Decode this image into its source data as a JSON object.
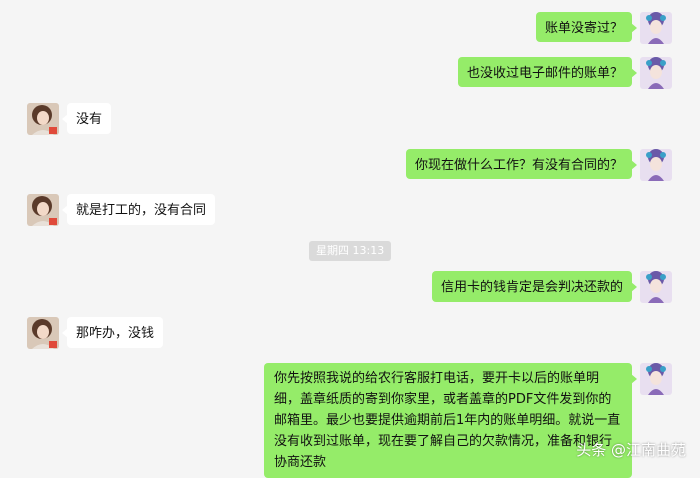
{
  "colors": {
    "self_bubble": "#95ec69",
    "other_bubble": "#ffffff",
    "background": "#f5f5f5"
  },
  "messages": [
    {
      "side": "right",
      "text": "账单没寄过？"
    },
    {
      "side": "right",
      "text": "也没收过电子邮件的账单？"
    },
    {
      "side": "left",
      "text": "没有"
    },
    {
      "side": "right",
      "text": "你现在做什么工作？有没有合同的？"
    },
    {
      "side": "left",
      "text": "就是打工的，没有合同"
    },
    {
      "side": "right",
      "text": "信用卡的钱肯定是会判决还款的"
    },
    {
      "side": "left",
      "text": "那咋办，没钱"
    },
    {
      "side": "right",
      "text": "你先按照我说的给农行客服打电话，要开卡以后的账单明细，盖章纸质的寄到你家里，或者盖章的PDF文件发到你的邮箱里。最少也要提供逾期前后1年内的账单明细。就说一直没有收到过账单，现在要了解自己的欠款情况，准备和银行协商还款"
    }
  ],
  "timestamp": "星期四 13:13",
  "watermark": "头条 @江南曲苑"
}
